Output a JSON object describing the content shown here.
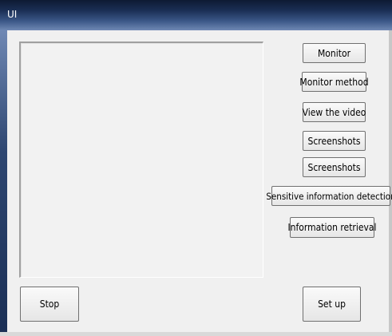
{
  "window": {
    "title": "UI"
  },
  "buttons": {
    "monitor": "Monitor",
    "monitor_method": "Monitor method",
    "view_video": "View the video",
    "screenshots_1": "Screenshots",
    "screenshots_2": "Screenshots",
    "sensitive_detection": "Sensitive information detection",
    "information_retrieval": "Information retrieval",
    "stop": "Stop",
    "set_up": "Set up"
  }
}
